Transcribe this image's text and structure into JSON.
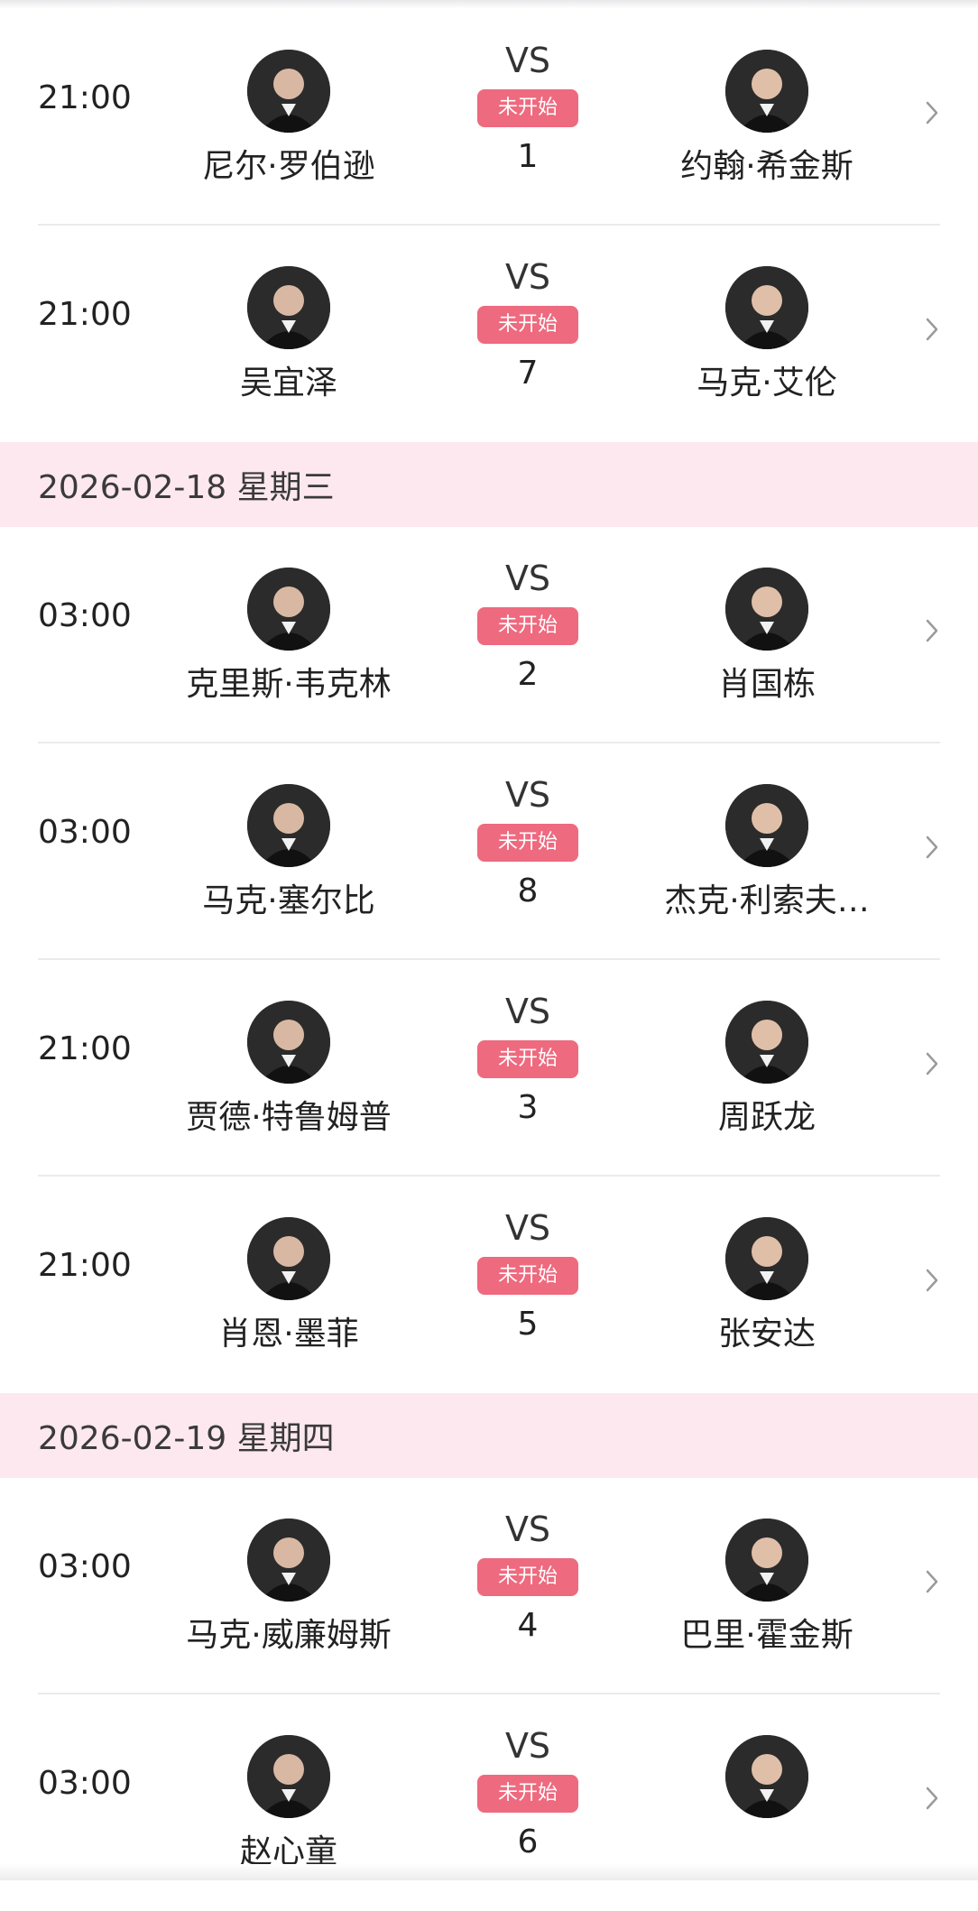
{
  "colors": {
    "accent": "#ee6a7f",
    "date_bg": "#fce8ee"
  },
  "vs_label": "VS",
  "groups": [
    {
      "date": "",
      "matches": [
        {
          "time": "21:00",
          "home": "尼尔·罗伯逊",
          "away": "约翰·希金斯",
          "status": "未开始",
          "number": "1"
        },
        {
          "time": "21:00",
          "home": "吴宜泽",
          "away": "马克·艾伦",
          "status": "未开始",
          "number": "7"
        }
      ]
    },
    {
      "date": "2026-02-18 星期三",
      "matches": [
        {
          "time": "03:00",
          "home": "克里斯·韦克林",
          "away": "肖国栋",
          "status": "未开始",
          "number": "2"
        },
        {
          "time": "03:00",
          "home": "马克·塞尔比",
          "away": "杰克·利索夫…",
          "status": "未开始",
          "number": "8"
        },
        {
          "time": "21:00",
          "home": "贾德·特鲁姆普",
          "away": "周跃龙",
          "status": "未开始",
          "number": "3"
        },
        {
          "time": "21:00",
          "home": "肖恩·墨菲",
          "away": "张安达",
          "status": "未开始",
          "number": "5"
        }
      ]
    },
    {
      "date": "2026-02-19 星期四",
      "matches": [
        {
          "time": "03:00",
          "home": "马克·威廉姆斯",
          "away": "巴里·霍金斯",
          "status": "未开始",
          "number": "4"
        },
        {
          "time": "03:00",
          "home": "赵心童",
          "away": "",
          "status": "未开始",
          "number": "6"
        }
      ]
    }
  ]
}
